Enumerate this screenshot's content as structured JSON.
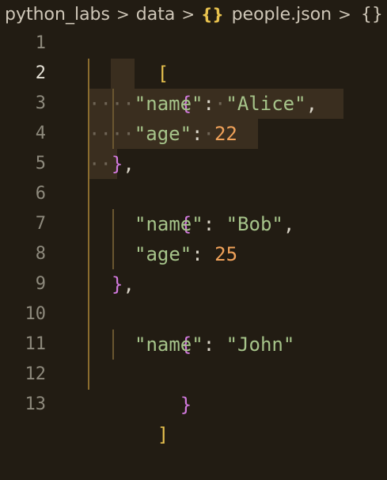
{
  "breadcrumb": {
    "items": [
      "python_labs",
      "data",
      "people.json"
    ],
    "separator": ">",
    "trail": "{}",
    "file_icon": "json-braces-icon"
  },
  "editor": {
    "line_numbers": [
      "1",
      "2",
      "3",
      "4",
      "5",
      "6",
      "7",
      "8",
      "9",
      "10",
      "11",
      "12",
      "13"
    ],
    "active_line": 2,
    "tokens": {
      "l1_open": "[",
      "l2_open": "{",
      "l3_ws": "····",
      "l3_key": "\"name\"",
      "l3_colon": ":",
      "l3_mid": "·",
      "l3_val": "\"Alice\"",
      "l3_comma": ",",
      "l4_ws": "····",
      "l4_key": "\"age\"",
      "l4_colon": ":",
      "l4_mid": "·",
      "l4_val": "22",
      "l5_ws": "··",
      "l5_close": "}",
      "l5_comma": ",",
      "l6_open": "{",
      "l7_key": "\"name\"",
      "l7_colon": ": ",
      "l7_val": "\"Bob\"",
      "l7_comma": ",",
      "l8_key": "\"age\"",
      "l8_colon": ": ",
      "l8_val": "25",
      "l9_close": "}",
      "l9_comma": ",",
      "l10_open": "{",
      "l11_key": "\"name\"",
      "l11_colon": ": ",
      "l11_val": "\"John\"",
      "l12_close": "}",
      "l13_close": "]"
    }
  },
  "colors": {
    "background": "#221c13",
    "selection": "#3a2e1f",
    "bracket_gold": "#e7c14e",
    "brace_purple": "#d37adf",
    "string_green": "#a6c48a",
    "number_orange": "#f0a25a"
  }
}
